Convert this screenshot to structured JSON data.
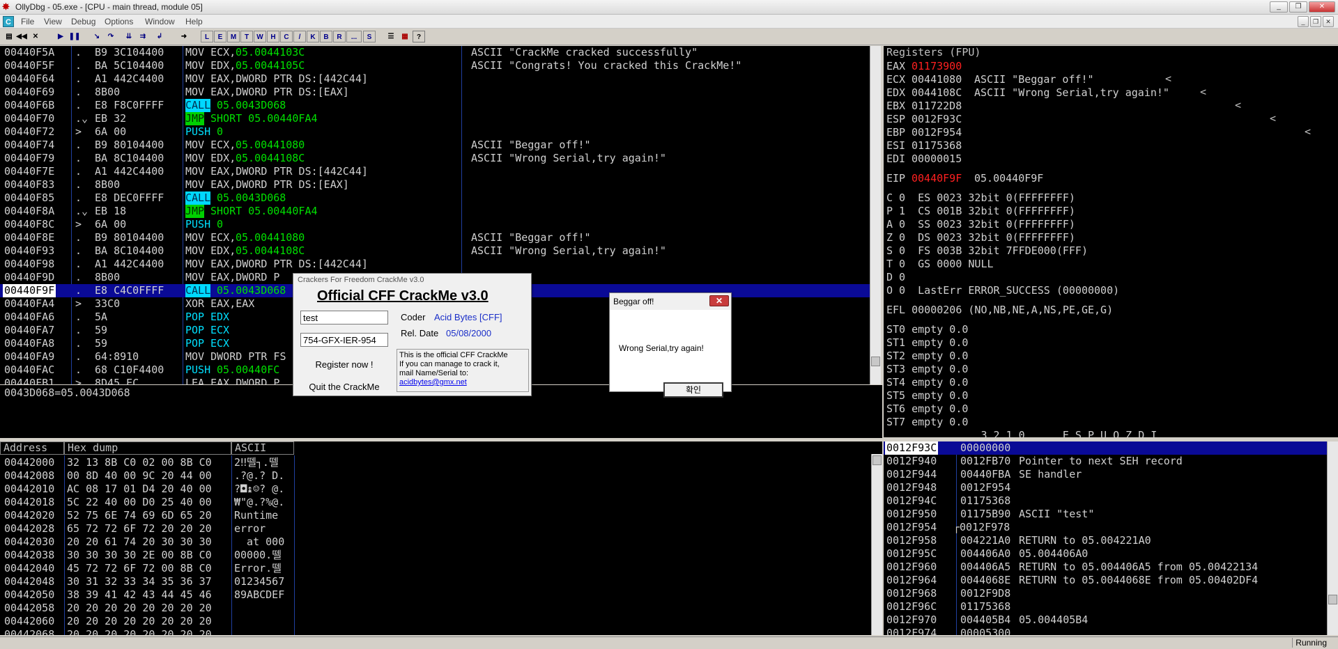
{
  "window": {
    "title": "OllyDbg - 05.exe - [CPU - main thread, module 05]",
    "app_icon": "C"
  },
  "menu": [
    "File",
    "View",
    "Debug",
    "Options",
    "Window",
    "Help"
  ],
  "toolbar": {
    "letters": [
      "L",
      "E",
      "M",
      "T",
      "W",
      "H",
      "C",
      "/",
      "K",
      "B",
      "R",
      "...",
      "S"
    ]
  },
  "cpu": {
    "rows": [
      {
        "addr": "00440F5A",
        "mark": ".",
        "hex": "B9 3C104400",
        "instr": "MOV ECX,",
        "arg": "05.0044103C",
        "comment": "ASCII \"CrackMe cracked successfully\""
      },
      {
        "addr": "00440F5F",
        "mark": ".",
        "hex": "BA 5C104400",
        "instr": "MOV EDX,",
        "arg": "05.0044105C",
        "comment": "ASCII \"Congrats! You cracked this CrackMe!\""
      },
      {
        "addr": "00440F64",
        "mark": ".",
        "hex": "A1 442C4400",
        "instr": "MOV EAX,DWORD PTR DS:[442C44]",
        "arg": "",
        "comment": ""
      },
      {
        "addr": "00440F69",
        "mark": ".",
        "hex": "8B00",
        "instr": "MOV EAX,DWORD PTR DS:[EAX]",
        "arg": "",
        "comment": ""
      },
      {
        "addr": "00440F6B",
        "mark": ".",
        "hex": "E8 F8C0FFFF",
        "kind": "call",
        "op": "CALL",
        "arg": "05.0043D068",
        "comment": ""
      },
      {
        "addr": "00440F70",
        "mark": ".⌄",
        "hex": "EB 32",
        "kind": "jmp",
        "op": "JMP",
        "arg": "SHORT 05.00440FA4",
        "comment": ""
      },
      {
        "addr": "00440F72",
        "mark": ">",
        "hex": "6A 00",
        "kind": "push",
        "op": "PUSH",
        "arg": "0",
        "comment": ""
      },
      {
        "addr": "00440F74",
        "mark": ".",
        "hex": "B9 80104400",
        "instr": "MOV ECX,",
        "arg": "05.00441080",
        "comment": "ASCII \"Beggar off!\""
      },
      {
        "addr": "00440F79",
        "mark": ".",
        "hex": "BA 8C104400",
        "instr": "MOV EDX,",
        "arg": "05.0044108C",
        "comment": "ASCII \"Wrong Serial,try again!\""
      },
      {
        "addr": "00440F7E",
        "mark": ".",
        "hex": "A1 442C4400",
        "instr": "MOV EAX,DWORD PTR DS:[442C44]",
        "arg": "",
        "comment": ""
      },
      {
        "addr": "00440F83",
        "mark": ".",
        "hex": "8B00",
        "instr": "MOV EAX,DWORD PTR DS:[EAX]",
        "arg": "",
        "comment": ""
      },
      {
        "addr": "00440F85",
        "mark": ".",
        "hex": "E8 DEC0FFFF",
        "kind": "call",
        "op": "CALL",
        "arg": "05.0043D068",
        "comment": ""
      },
      {
        "addr": "00440F8A",
        "mark": ".⌄",
        "hex": "EB 18",
        "kind": "jmp",
        "op": "JMP",
        "arg": "SHORT 05.00440FA4",
        "comment": ""
      },
      {
        "addr": "00440F8C",
        "mark": ">",
        "hex": "6A 00",
        "kind": "push",
        "op": "PUSH",
        "arg": "0",
        "comment": ""
      },
      {
        "addr": "00440F8E",
        "mark": ".",
        "hex": "B9 80104400",
        "instr": "MOV ECX,",
        "arg": "05.00441080",
        "comment": "ASCII \"Beggar off!\""
      },
      {
        "addr": "00440F93",
        "mark": ".",
        "hex": "BA 8C104400",
        "instr": "MOV EDX,",
        "arg": "05.0044108C",
        "comment": "ASCII \"Wrong Serial,try again!\""
      },
      {
        "addr": "00440F98",
        "mark": ".",
        "hex": "A1 442C4400",
        "instr": "MOV EAX,DWORD PTR DS:[442C44]",
        "arg": "",
        "comment": ""
      },
      {
        "addr": "00440F9D",
        "mark": ".",
        "hex": "8B00",
        "instr": "MOV EAX,DWORD P",
        "arg": "",
        "comment": ""
      },
      {
        "addr": "00440F9F",
        "mark": ".",
        "hex": "E8 C4C0FFFF",
        "kind": "call",
        "op": "CALL",
        "arg": "05.0043D068",
        "comment": "",
        "selected": true
      },
      {
        "addr": "00440FA4",
        "mark": ">",
        "hex": "33C0",
        "instr": "XOR EAX,EAX",
        "arg": "",
        "comment": ""
      },
      {
        "addr": "00440FA6",
        "mark": ".",
        "hex": "5A",
        "kind": "pop",
        "op": "POP",
        "arg": "EDX",
        "comment": ""
      },
      {
        "addr": "00440FA7",
        "mark": ".",
        "hex": "59",
        "kind": "pop",
        "op": "POP",
        "arg": "ECX",
        "comment": ""
      },
      {
        "addr": "00440FA8",
        "mark": ".",
        "hex": "59",
        "kind": "pop",
        "op": "POP",
        "arg": "ECX",
        "comment": ""
      },
      {
        "addr": "00440FA9",
        "mark": ".",
        "hex": "64:8910",
        "instr": "MOV DWORD PTR FS",
        "arg": "",
        "comment": ""
      },
      {
        "addr": "00440FAC",
        "mark": ".",
        "hex": "68 C10F4400",
        "kind": "push",
        "op": "PUSH",
        "arg": "05.00440FC",
        "comment": ""
      },
      {
        "addr": "00440FB1",
        "mark": ">",
        "hex": "8D45 EC",
        "instr": "LEA EAX,DWORD P",
        "arg": "",
        "comment": ""
      }
    ]
  },
  "info_line": "0043D068=05.0043D068",
  "registers": {
    "header": "Registers (FPU)",
    "arrows": [
      "<",
      "<",
      "<",
      "<",
      "<"
    ],
    "lines": [
      {
        "name": "EAX",
        "value": "01173900",
        "red": true,
        "note": ""
      },
      {
        "name": "ECX",
        "value": "00441080",
        "note": "ASCII \"Beggar off!\""
      },
      {
        "name": "EDX",
        "value": "0044108C",
        "note": "ASCII \"Wrong Serial,try again!\""
      },
      {
        "name": "EBX",
        "value": "011722D8",
        "note": ""
      },
      {
        "name": "ESP",
        "value": "0012F93C",
        "note": ""
      },
      {
        "name": "EBP",
        "value": "0012F954",
        "note": ""
      },
      {
        "name": "ESI",
        "value": "01175368",
        "note": ""
      },
      {
        "name": "EDI",
        "value": "00000015",
        "note": ""
      },
      {
        "gap": true
      },
      {
        "name": "EIP",
        "value": "00440F9F",
        "red": true,
        "note": "05.00440F9F"
      },
      {
        "gap": true
      },
      {
        "raw": "C 0  ES 0023 32bit 0(FFFFFFFF)"
      },
      {
        "raw": "P 1  CS 001B 32bit 0(FFFFFFFF)"
      },
      {
        "raw": "A 0  SS 0023 32bit 0(FFFFFFFF)"
      },
      {
        "raw": "Z 0  DS 0023 32bit 0(FFFFFFFF)"
      },
      {
        "raw": "S 0  FS 003B 32bit 7FFDE000(FFF)"
      },
      {
        "raw": "T 0  GS 0000 NULL"
      },
      {
        "raw": "D 0"
      },
      {
        "raw": "O 0  LastErr ERROR_SUCCESS (00000000)"
      },
      {
        "gap": true
      },
      {
        "raw": "EFL 00000206 (NO,NB,NE,A,NS,PE,GE,G)"
      },
      {
        "gap": true
      },
      {
        "raw": "ST0 empty 0.0"
      },
      {
        "raw": "ST1 empty 0.0"
      },
      {
        "raw": "ST2 empty 0.0"
      },
      {
        "raw": "ST3 empty 0.0"
      },
      {
        "raw": "ST4 empty 0.0"
      },
      {
        "raw": "ST5 empty 0.0"
      },
      {
        "raw": "ST6 empty 0.0"
      },
      {
        "raw": "ST7 empty 0.0"
      },
      {
        "raw": "               3 2 1 0      E S P U O Z D I"
      }
    ]
  },
  "dump": {
    "headers": {
      "address": "Address",
      "hex": "Hex dump",
      "ascii": "ASCII"
    },
    "rows": [
      {
        "addr": "00442000",
        "hex": "32 13 8B C0 02 00 8B C0",
        "ascii": "2‼뗄┐.뗄"
      },
      {
        "addr": "00442008",
        "hex": "00 8D 40 00 9C 20 44 00",
        "ascii": ".?@.? D."
      },
      {
        "addr": "00442010",
        "hex": "AC 08 17 01 D4 20 40 00",
        "ascii": "?◘↨☺? @."
      },
      {
        "addr": "00442018",
        "hex": "5C 22 40 00 D0 25 40 00",
        "ascii": "₩\"@.?%@."
      },
      {
        "addr": "00442020",
        "hex": "52 75 6E 74 69 6D 65 20",
        "ascii": "Runtime "
      },
      {
        "addr": "00442028",
        "hex": "65 72 72 6F 72 20 20 20",
        "ascii": "error   "
      },
      {
        "addr": "00442030",
        "hex": "20 20 61 74 20 30 30 30",
        "ascii": "  at 000"
      },
      {
        "addr": "00442038",
        "hex": "30 30 30 30 2E 00 8B C0",
        "ascii": "00000.뗄"
      },
      {
        "addr": "00442040",
        "hex": "45 72 72 6F 72 00 8B C0",
        "ascii": "Error.뗄"
      },
      {
        "addr": "00442048",
        "hex": "30 31 32 33 34 35 36 37",
        "ascii": "01234567"
      },
      {
        "addr": "00442050",
        "hex": "38 39 41 42 43 44 45 46",
        "ascii": "89ABCDEF"
      },
      {
        "addr": "00442058",
        "hex": "20 20 20 20 20 20 20 20",
        "ascii": ""
      },
      {
        "addr": "00442060",
        "hex": "20 20 20 20 20 20 20 20",
        "ascii": ""
      },
      {
        "addr": "00442068",
        "hex": "20 20 20 20 20 20 20 20",
        "ascii": ""
      }
    ]
  },
  "stack": {
    "rows": [
      {
        "addr": "0012F93C",
        "val": "00000000",
        "note": "",
        "selected": true
      },
      {
        "addr": "0012F940",
        "val": "0012FB70",
        "note": "Pointer to next SEH record"
      },
      {
        "addr": "0012F944",
        "val": "00440FBA",
        "note": "SE handler"
      },
      {
        "addr": "0012F948",
        "val": "0012F954",
        "note": ""
      },
      {
        "addr": "0012F94C",
        "val": "01175368",
        "note": ""
      },
      {
        "addr": "0012F950",
        "val": "01175B90",
        "note": "ASCII \"test\""
      },
      {
        "addr": "0012F954",
        "val": "0012F978",
        "note": "",
        "bracket": true
      },
      {
        "addr": "0012F958",
        "val": "004221A0",
        "note": "RETURN to 05.004221A0"
      },
      {
        "addr": "0012F95C",
        "val": "004406A0",
        "note": "05.004406A0"
      },
      {
        "addr": "0012F960",
        "val": "004406A5",
        "note": "RETURN to 05.004406A5 from 05.00422134"
      },
      {
        "addr": "0012F964",
        "val": "0044068E",
        "note": "RETURN to 05.0044068E from 05.00402DF4"
      },
      {
        "addr": "0012F968",
        "val": "0012F9D8",
        "note": ""
      },
      {
        "addr": "0012F96C",
        "val": "01175368",
        "note": ""
      },
      {
        "addr": "0012F970",
        "val": "004405B4",
        "note": "05.004405B4"
      },
      {
        "addr": "0012F974",
        "val": "00005300",
        "note": ""
      }
    ]
  },
  "crackme": {
    "caption": "Crackers For Freedom CrackMe v3.0",
    "title": "Official CFF CrackMe v3.0",
    "name_value": "test",
    "serial_value": "754-GFX-IER-954",
    "coder_label": "Coder",
    "coder_value": "Acid Bytes [CFF]",
    "date_label": "Rel. Date",
    "date_value": "05/08/2000",
    "register_button": "Register now !",
    "quit_button": "Quit the CrackMe",
    "note_l1": "This is the official CFF CrackMe",
    "note_l2": "If you can manage to crack it,",
    "note_l3": "mail Name/Serial to:",
    "email": "acidbytes@gmx.net"
  },
  "msgbox": {
    "caption": "Beggar off!",
    "message": "Wrong Serial,try again!",
    "ok": "확인",
    "close": "✕"
  },
  "status": "Running"
}
